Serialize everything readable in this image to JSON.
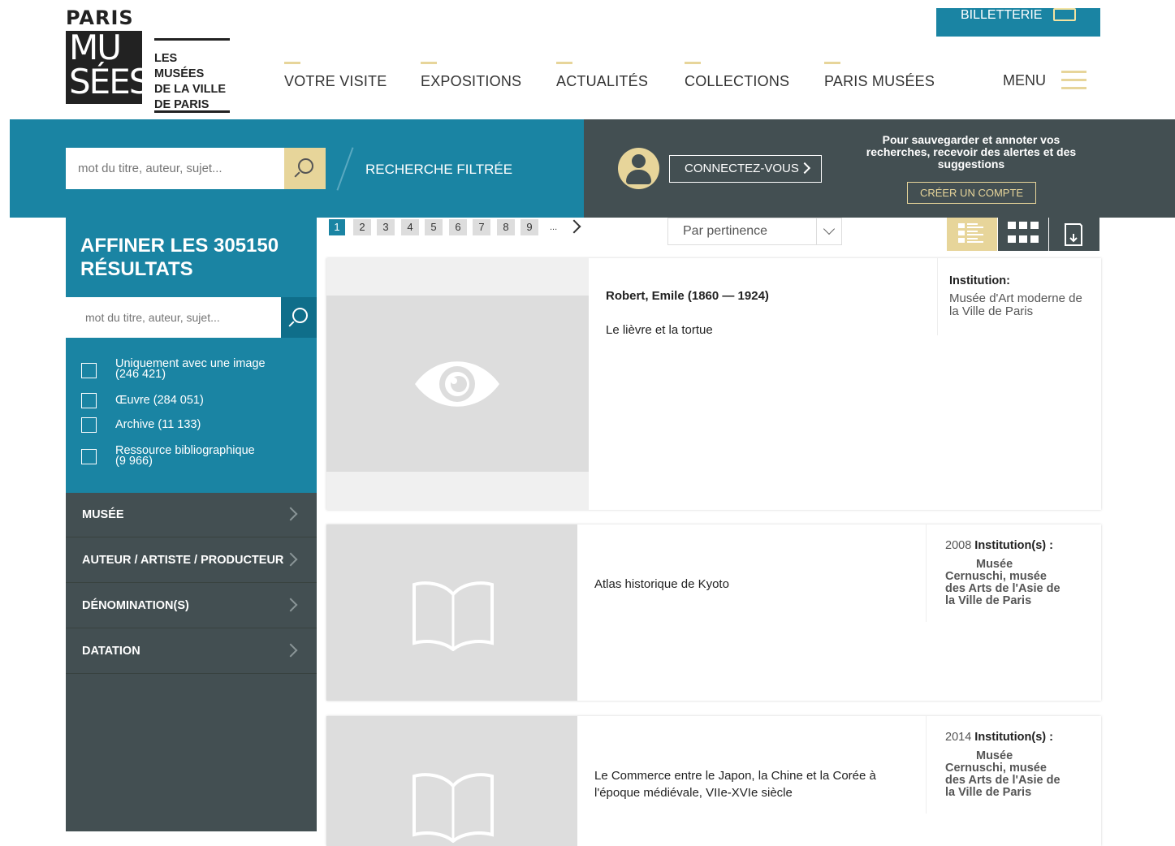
{
  "header": {
    "logo_top": "PARIS",
    "logo_box_line1": "MU",
    "logo_box_line2": "SÉES",
    "logo_text_1": "LES MUSÉES",
    "logo_text_2": "DE LA VILLE",
    "logo_text_3": "DE PARIS",
    "ticketing": "BILLETTERIE",
    "menu_label": "MENU",
    "nav": [
      "VOTRE VISITE",
      "EXPOSITIONS",
      "ACTUALITÉS",
      "COLLECTIONS",
      "PARIS MUSÉES"
    ]
  },
  "search_bar": {
    "placeholder": "mot du titre, auteur, sujet...",
    "filtered_label": "RECHERCHE FILTRÉE"
  },
  "account": {
    "connect_label": "CONNECTEZ-VOUS",
    "promo_line1": "Pour sauvegarder et annoter vos",
    "promo_line2": "recherches, recevoir des alertes et des",
    "promo_line3": "suggestions",
    "create_label": "CRÉER UN COMPTE"
  },
  "sidebar": {
    "refine_line1": "AFFINER LES 305150",
    "refine_line2": "RÉSULTATS",
    "search_placeholder": "mot du titre, auteur, sujet...",
    "filters": [
      {
        "line1": "Uniquement avec une image",
        "line2": "(246 421)"
      },
      {
        "line1": "Œuvre (284 051)",
        "line2": ""
      },
      {
        "line1": "Archive (11 133)",
        "line2": ""
      },
      {
        "line1": "Ressource bibliographique",
        "line2": "(9 966)"
      }
    ],
    "facets": [
      "MUSÉE",
      "AUTEUR / ARTISTE / PRODUCTEUR",
      "DÉNOMINATION(S)",
      "DATATION"
    ]
  },
  "pagination": {
    "pages": [
      "1",
      "2",
      "3",
      "4",
      "5",
      "6",
      "7",
      "8",
      "9"
    ],
    "current": "1",
    "ellipsis": "..."
  },
  "sort": {
    "selected": "Par pertinence"
  },
  "results": [
    {
      "author": "Robert, Emile (1860 — 1924)",
      "title": "Le lièvre et la tortue",
      "inst_label": "Institution:",
      "inst_line1": "Musée d'Art moderne de",
      "inst_line2": "la Ville de Paris",
      "thumb_icon": "eye-icon"
    },
    {
      "title": "Atlas historique de Kyoto",
      "year": "2008",
      "inst_label": "Institution(s) :",
      "inst_line1": "Musée",
      "inst_line2": "Cernuschi, musée",
      "inst_line3": "des Arts de l'Asie de",
      "inst_line4": "la Ville de Paris",
      "thumb_icon": "book-icon"
    },
    {
      "title_line1": "Le Commerce entre le Japon, la Chine et la Corée à",
      "title_line2": "l'époque médiévale, VIIe-XVIe siècle",
      "year": "2014",
      "inst_label": "Institution(s) :",
      "inst_line1": "Musée",
      "inst_line2": "Cernuschi, musée",
      "inst_line3": "des Arts de l'Asie de",
      "inst_line4": "la Ville de Paris",
      "thumb_icon": "book-icon"
    }
  ],
  "colors": {
    "teal": "#1a84a3",
    "dark": "#434f52",
    "gold": "#e7d59a"
  }
}
